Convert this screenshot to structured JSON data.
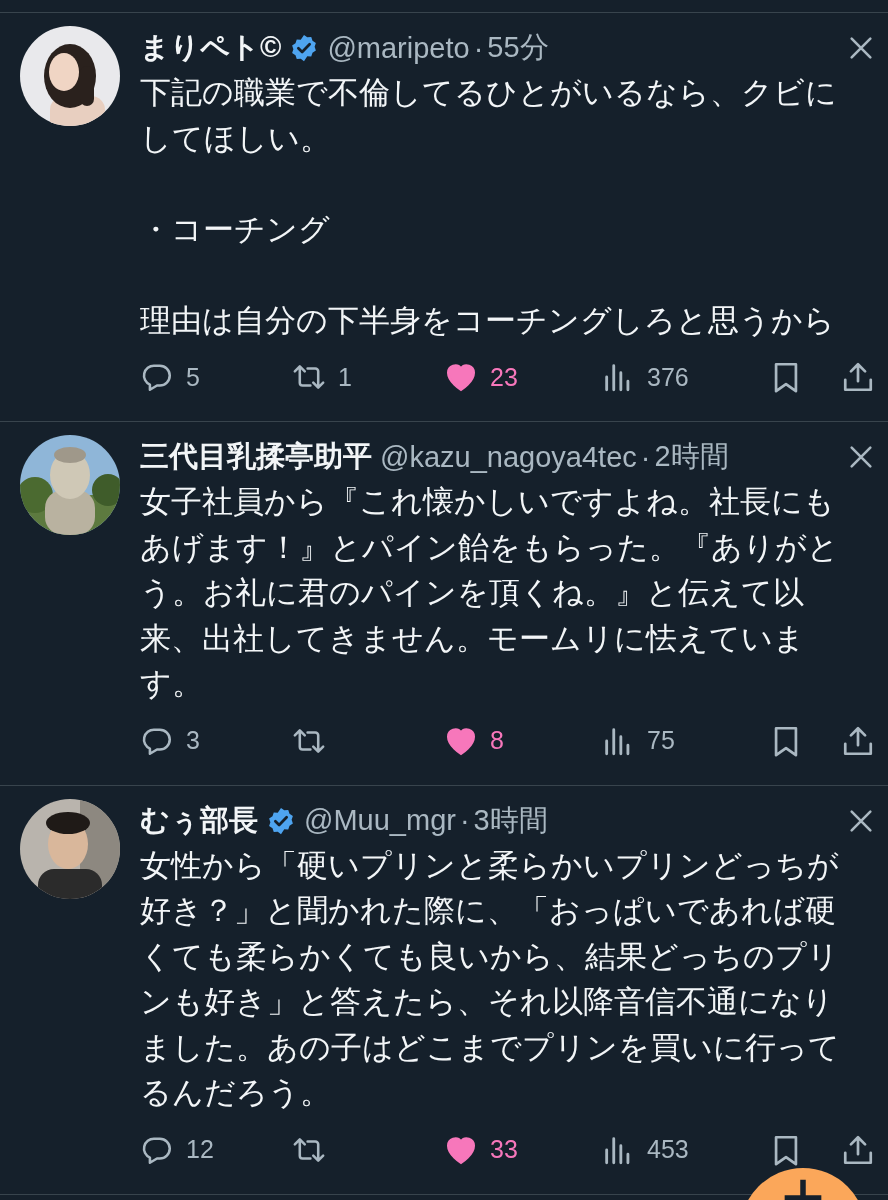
{
  "tweets": [
    {
      "name": "まりペト©",
      "verified": true,
      "handle": "@maripeto",
      "separator": "·",
      "time": "55分",
      "paragraphs": [
        "下記の職業で不倫してるひとがいるなら、クビにしてほしい。",
        "・コーチング",
        "理由は自分の下半身をコーチングしろと思うから"
      ],
      "replies": "5",
      "retweets": "1",
      "likes": "23",
      "liked": true,
      "views": "376"
    },
    {
      "name": "三代目乳揉亭助平",
      "verified": false,
      "handle": "@kazu_nagoya4tec",
      "separator": "·",
      "time": "2時間",
      "paragraphs": [
        "女子社員から『これ懐かしいですよね。社長にもあげます！』とパイン飴をもらった。『ありがとう。お礼に君のパインを頂くね。』と伝えて以来、出社してきません。モームリに怯えています。"
      ],
      "replies": "3",
      "likes": "8",
      "liked": true,
      "views": "75"
    },
    {
      "name": "むぅ部長",
      "verified": true,
      "handle": "@Muu_mgr",
      "separator": "·",
      "time": "3時間",
      "paragraphs": [
        "女性から「硬いプリンと柔らかいプリンどっちが好き？」と聞かれた際に、「おっぱいであれば硬くても柔らかくても良いから、結果どっちのプリンも好き」と答えたら、それ以降音信不通になりました。あの子はどこまでプリンを買いに行ってるんだろう。"
      ],
      "replies": "12",
      "likes": "33",
      "liked": true,
      "views": "453"
    }
  ],
  "compose_button": {
    "kind": "fab"
  }
}
